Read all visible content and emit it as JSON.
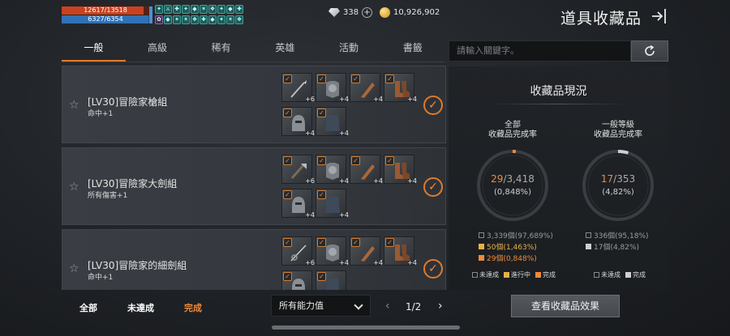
{
  "hud": {
    "hp_text": "12617/13518",
    "mp_text": "6327/6354",
    "hp_fraction": 0.933,
    "mp_fraction": 0.996,
    "diamonds": "338",
    "gold": "10,926,902"
  },
  "header": {
    "title": "道具收藏品",
    "exit_icon": "exit-arrow-icon"
  },
  "tabs": [
    {
      "label": "一般",
      "active": true
    },
    {
      "label": "高級",
      "active": false
    },
    {
      "label": "稀有",
      "active": false
    },
    {
      "label": "英雄",
      "active": false
    },
    {
      "label": "活動",
      "active": false
    },
    {
      "label": "書籤",
      "active": false
    }
  ],
  "search": {
    "placeholder": "請輸入關鍵字。"
  },
  "sets": [
    {
      "name": "[LV30]冒險家槍組",
      "effect": "命中+1",
      "items": [
        {
          "icon": "spear-icon",
          "enhance": "+6"
        },
        {
          "icon": "armor-icon",
          "enhance": "+4"
        },
        {
          "icon": "gauntlet-icon",
          "enhance": "+4"
        },
        {
          "icon": "boots-icon",
          "enhance": "+4"
        },
        {
          "icon": "helmet-icon",
          "enhance": "+4"
        },
        {
          "icon": "cloak-icon",
          "enhance": "+4"
        }
      ]
    },
    {
      "name": "[LV30]冒險家大劍組",
      "effect": "所有傷害+1",
      "items": [
        {
          "icon": "greatsword-icon",
          "enhance": "+6"
        },
        {
          "icon": "armor-icon",
          "enhance": "+4"
        },
        {
          "icon": "gauntlet-icon",
          "enhance": "+4"
        },
        {
          "icon": "boots-icon",
          "enhance": "+4"
        },
        {
          "icon": "helmet-icon",
          "enhance": "+4"
        },
        {
          "icon": "cloak-icon",
          "enhance": "+4"
        }
      ]
    },
    {
      "name": "[LV30]冒險家的細劍組",
      "effect": "命中+1",
      "items": [
        {
          "icon": "rapier-icon",
          "enhance": "+6"
        },
        {
          "icon": "armor-icon",
          "enhance": "+4"
        },
        {
          "icon": "gauntlet-icon",
          "enhance": "+4"
        },
        {
          "icon": "boots-icon",
          "enhance": "+4"
        },
        {
          "icon": "helmet-icon",
          "enhance": ""
        },
        {
          "icon": "cloak-icon",
          "enhance": ""
        }
      ]
    }
  ],
  "filters": {
    "all": "全部",
    "incomplete": "未達成",
    "complete": "完成"
  },
  "dropdown": {
    "value": "所有能力值"
  },
  "pager": {
    "text": "1/2",
    "prev": "‹",
    "next": "›"
  },
  "panel": {
    "title": "收藏品現況",
    "left": {
      "label1": "全部",
      "label2": "收藏品完成率",
      "done": "29",
      "total": "/3,418",
      "pct": "(0,848%)",
      "fraction": 0.00848,
      "stats": [
        "3,339個(97,689%)",
        "50個(1,463%)",
        "29個(0,848%)"
      ]
    },
    "right": {
      "label1": "一般等級",
      "label2": "收藏品完成率",
      "done": "17",
      "total": "/353",
      "pct": "(4,82%)",
      "fraction": 0.0482,
      "stats": [
        "336個(95,18%)",
        "17個(4,82%)"
      ]
    },
    "legend_left": [
      "未達成",
      "進行中",
      "完成"
    ],
    "legend_right": [
      "未達成",
      "完成"
    ],
    "view_button": "查看收藏品效果"
  },
  "colors": {
    "accent": "#f08a3a",
    "in_progress": "#e8b04a",
    "complete_gray": "#cfcfcf"
  }
}
